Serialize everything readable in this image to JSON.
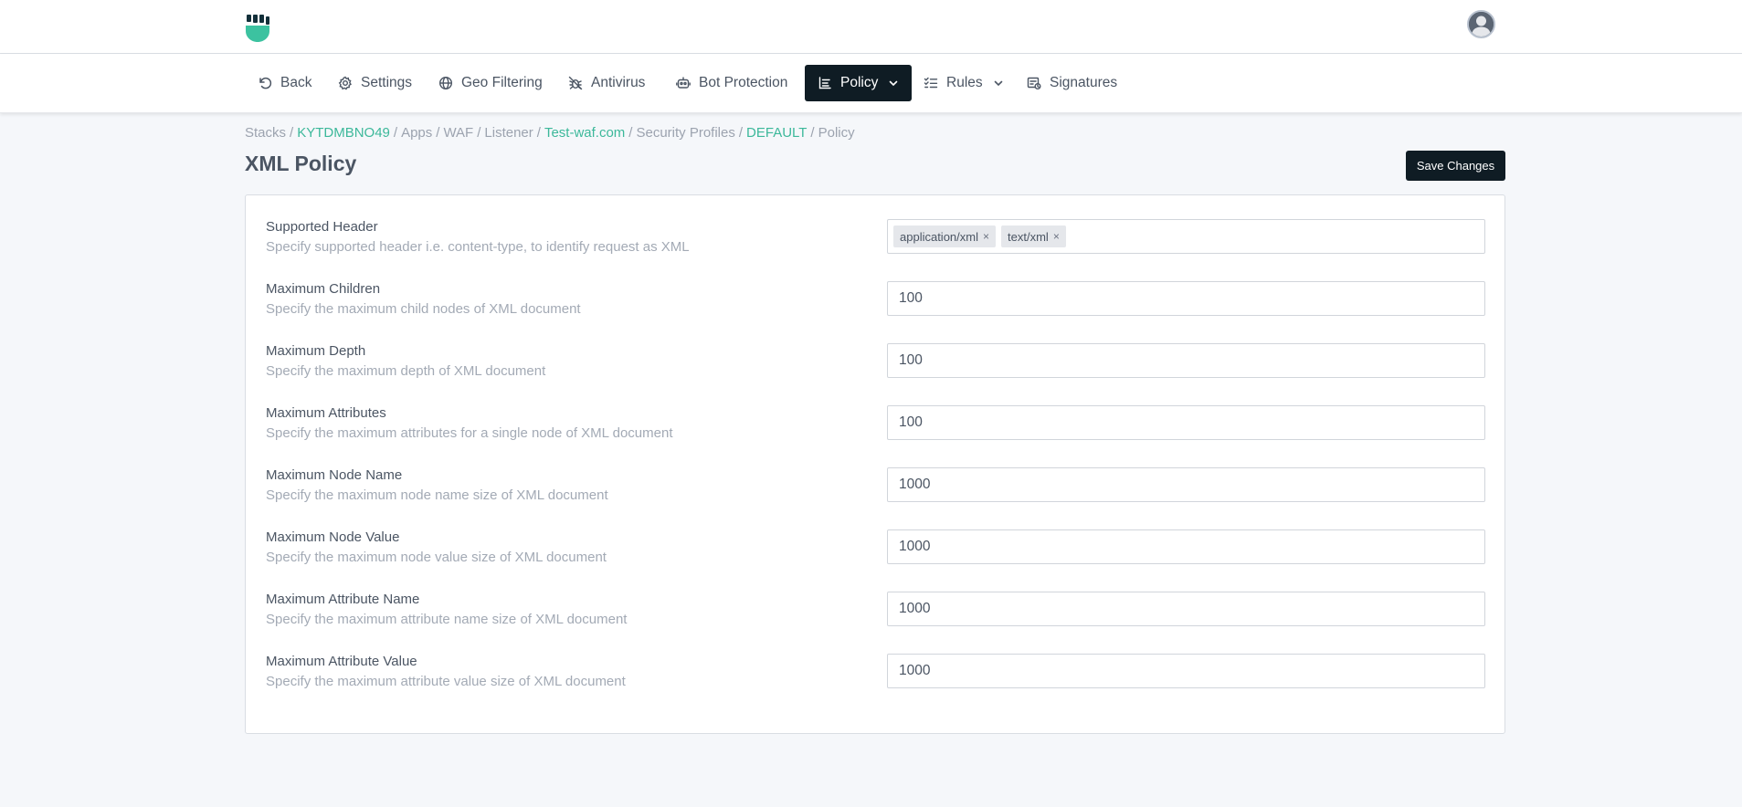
{
  "nav": {
    "items": [
      {
        "label": "Back",
        "icon": "undo-icon"
      },
      {
        "label": "Settings",
        "icon": "gear-icon"
      },
      {
        "label": "Geo Filtering",
        "icon": "globe-icon"
      },
      {
        "label": "Antivirus",
        "icon": "bug-off-icon"
      },
      {
        "label": "Bot Protection",
        "icon": "robot-icon"
      },
      {
        "label": "Policy",
        "icon": "checklist-icon",
        "active": true
      },
      {
        "label": "Rules",
        "icon": "list-check-icon"
      },
      {
        "label": "Signatures",
        "icon": "signature-list-icon"
      }
    ]
  },
  "breadcrumb": {
    "stacks": "Stacks",
    "stack_id": "KYTDMBNO49",
    "apps": "Apps",
    "waf": "WAF",
    "listener": "Listener",
    "listener_name": "Test-waf.com",
    "security_profiles": "Security Profiles",
    "profile": "DEFAULT",
    "current": "Policy"
  },
  "page": {
    "title": "XML Policy",
    "save_label": "Save Changes"
  },
  "settings": [
    {
      "label": "Supported Header",
      "desc": "Specify supported header i.e. content-type, to identify request as XML",
      "tags": [
        "application/xml",
        "text/xml"
      ]
    },
    {
      "label": "Maximum Children",
      "desc": "Specify the maximum child nodes of XML document",
      "value": "100"
    },
    {
      "label": "Maximum Depth",
      "desc": "Specify the maximum depth of XML document",
      "value": "100"
    },
    {
      "label": "Maximum Attributes",
      "desc": "Specify the maximum attributes for a single node of XML document",
      "value": "100"
    },
    {
      "label": "Maximum Node Name",
      "desc": "Specify the maximum node name size of XML document",
      "value": "1000"
    },
    {
      "label": "Maximum Node Value",
      "desc": "Specify the maximum node value size of XML document",
      "value": "1000"
    },
    {
      "label": "Maximum Attribute Name",
      "desc": "Specify the maximum attribute name size of XML document",
      "value": "1000"
    },
    {
      "label": "Maximum Attribute Value",
      "desc": "Specify the maximum attribute value size of XML document",
      "value": "1000"
    }
  ],
  "colors": {
    "accent": "#3cb89a",
    "dark": "#0f1c24",
    "background": "#f5f7fa"
  }
}
